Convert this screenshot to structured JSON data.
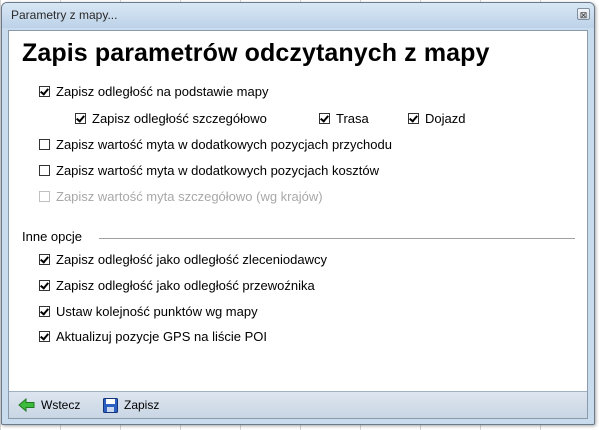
{
  "window": {
    "title": "Parametry z mapy...",
    "close_glyph": "⊠"
  },
  "heading": "Zapis parametrów odczytanych z mapy",
  "options": {
    "distance_from_map": {
      "label": "Zapisz odległość na podstawie mapy",
      "checked": true
    },
    "distance_detailed": {
      "label": "Zapisz odległość szczegółowo",
      "checked": true
    },
    "route": {
      "label": "Trasa",
      "checked": true
    },
    "approach": {
      "label": "Dojazd",
      "checked": true
    },
    "toll_income": {
      "label": "Zapisz wartość myta w dodatkowych pozycjach przychodu",
      "checked": false
    },
    "toll_cost": {
      "label": "Zapisz wartość myta w dodatkowych pozycjach kosztów",
      "checked": false
    },
    "toll_detailed": {
      "label": "Zapisz wartość myta szczegółowo (wg krajów)",
      "checked": false,
      "disabled": true
    }
  },
  "other": {
    "section_label": "Inne opcje",
    "client_distance": {
      "label": "Zapisz odległość jako odległość zleceniodawcy",
      "checked": true
    },
    "carrier_distance": {
      "label": "Zapisz odległość jako odległość przewoźnika",
      "checked": true
    },
    "point_order": {
      "label": "Ustaw kolejność punktów wg mapy",
      "checked": true
    },
    "update_gps": {
      "label": "Aktualizuj pozycje GPS na liście POI",
      "checked": true
    }
  },
  "footer": {
    "back_label": "Wstecz",
    "save_label": "Zapisz"
  },
  "colors": {
    "accent_green": "#2e9e2e",
    "save_blue": "#1f4fa8"
  },
  "icons": {
    "back": "arrow-left-icon",
    "save": "floppy-disk-icon"
  }
}
